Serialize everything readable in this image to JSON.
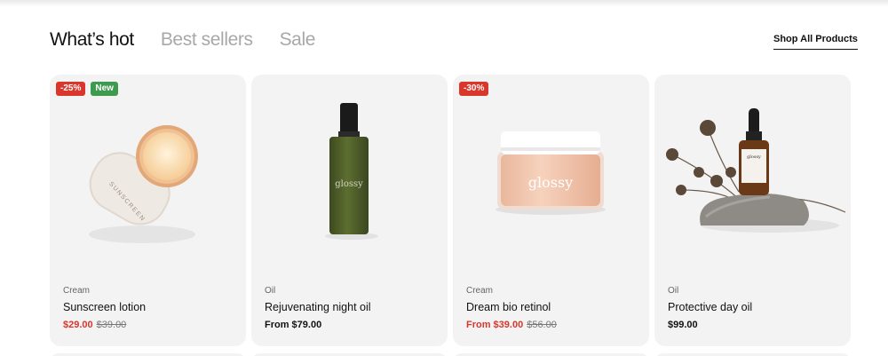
{
  "tabs": [
    {
      "label": "What’s hot",
      "active": true
    },
    {
      "label": "Best sellers",
      "active": false
    },
    {
      "label": "Sale",
      "active": false
    }
  ],
  "shop_all_label": "Shop All Products",
  "products": [
    {
      "badges": [
        "-25%",
        "New"
      ],
      "category": "Cream",
      "name": "Sunscreen lotion",
      "price": "$29.00",
      "old_price": "$39.00",
      "price_red": true,
      "image": "sunscreen-jar-image"
    },
    {
      "badges": [],
      "category": "Oil",
      "name": "Rejuvenating night oil",
      "price": "From $79.00",
      "old_price": "",
      "price_red": false,
      "image": "oil-bottle-image",
      "brand_text": "glossy"
    },
    {
      "badges": [
        "-30%"
      ],
      "category": "Cream",
      "name": "Dream bio retinol",
      "price": "From $39.00",
      "old_price": "$56.00",
      "price_red": true,
      "image": "retinol-jar-image",
      "brand_text": "glossy"
    },
    {
      "badges": [],
      "category": "Oil",
      "name": "Protective day oil",
      "price": "$99.00",
      "old_price": "",
      "price_red": false,
      "image": "dropper-bottle-image",
      "brand_text": "glossy"
    }
  ],
  "colors": {
    "sale_badge": "#d9362c",
    "new_badge": "#3e9a4e",
    "card_bg": "#f3f3f3"
  }
}
